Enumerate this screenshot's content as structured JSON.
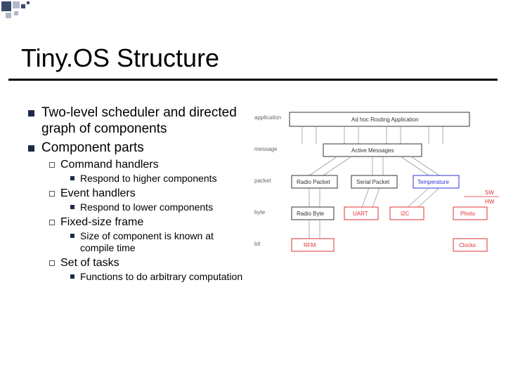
{
  "title": "Tiny.OS Structure",
  "bullets": [
    {
      "text": "Two-level scheduler and directed graph of components"
    },
    {
      "text": "Component parts"
    }
  ],
  "sub": [
    {
      "label": "Command handlers",
      "child": "Respond to higher components"
    },
    {
      "label": "Event handlers",
      "child": "Respond to lower components"
    },
    {
      "label": "Fixed-size frame",
      "child": "Size of component is known at compile time"
    },
    {
      "label": "Set of tasks",
      "child": "Functions to do arbitrary computation"
    }
  ],
  "diagram": {
    "layers": [
      "application",
      "message",
      "packet",
      "byte",
      "bit"
    ],
    "top_box": "Ad hoc Routing Application",
    "row2": [
      "Active Messages"
    ],
    "row3": [
      "Radio Packet",
      "Serial Packet",
      "Temperature"
    ],
    "row4": [
      "Radio Byte",
      "UART",
      "I2C",
      "Photo"
    ],
    "row5": [
      "RFM",
      "Clocks"
    ],
    "right_labels": [
      "SW",
      "HW"
    ]
  }
}
